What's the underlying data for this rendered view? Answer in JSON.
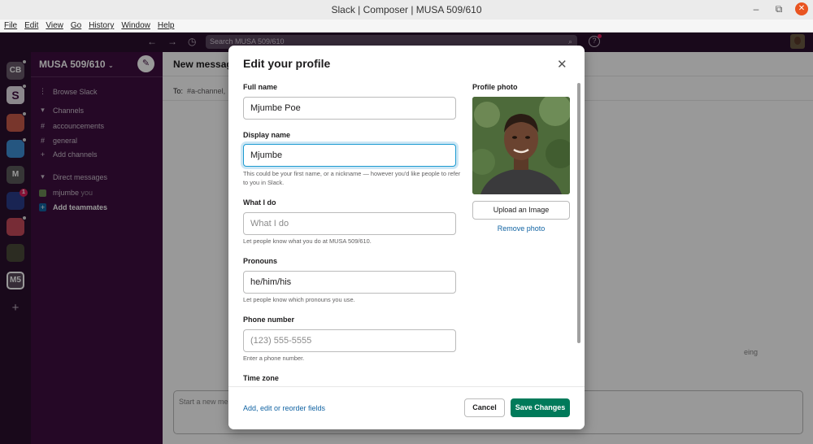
{
  "window": {
    "title": "Slack | Composer | MUSA 509/610"
  },
  "menubar": [
    "File",
    "Edit",
    "View",
    "Go",
    "History",
    "Window",
    "Help"
  ],
  "topbar": {
    "search_placeholder": "Search MUSA 509/610"
  },
  "rail": {
    "workspaces": [
      {
        "label": "CB",
        "color": "#6a5a6c"
      },
      {
        "label": "S",
        "color": "#e8e3e9"
      },
      {
        "label": "",
        "color": "#c95a4a"
      },
      {
        "label": "",
        "color": "#3f8fd6"
      },
      {
        "label": "M",
        "color": "#5a5a5a"
      },
      {
        "label": "",
        "color": "#2a3c8a",
        "badge": "1"
      },
      {
        "label": "",
        "color": "#c74a5a"
      },
      {
        "label": "",
        "color": "#4a4a3a"
      },
      {
        "label": "M5",
        "color": "#5a4a5c"
      }
    ],
    "add": "+"
  },
  "sidebar": {
    "workspace_name": "MUSA 509/610",
    "browse": "Browse Slack",
    "channels_header": "Channels",
    "channels": [
      "accouncements",
      "general"
    ],
    "add_channels": "Add channels",
    "dm_header": "Direct messages",
    "dm_user": "mjumbe",
    "dm_you": "you",
    "add_teammates": "Add teammates"
  },
  "main": {
    "title": "New message",
    "to_label": "To:",
    "to_value": "#a-channel,",
    "message_placeholder": "Start a new me",
    "bg_partial": "eing"
  },
  "modal": {
    "title": "Edit your profile",
    "full_name_label": "Full name",
    "full_name_value": "Mjumbe Poe",
    "display_name_label": "Display name",
    "display_name_value": "Mjumbe",
    "display_name_hint": "This could be your first name, or a nickname — however you'd like people to refer to you in Slack.",
    "what_i_do_label": "What I do",
    "what_i_do_placeholder": "What I do",
    "what_i_do_hint": "Let people know what you do at MUSA 509/610.",
    "pronouns_label": "Pronouns",
    "pronouns_value": "he/him/his",
    "pronouns_hint": "Let people know which pronouns you use.",
    "phone_label": "Phone number",
    "phone_placeholder": "(123) 555-5555",
    "phone_hint": "Enter a phone number.",
    "timezone_label": "Time zone",
    "photo_label": "Profile photo",
    "upload_label": "Upload an Image",
    "remove_label": "Remove photo",
    "fields_link": "Add, edit or reorder fields",
    "cancel_label": "Cancel",
    "save_label": "Save Changes"
  }
}
